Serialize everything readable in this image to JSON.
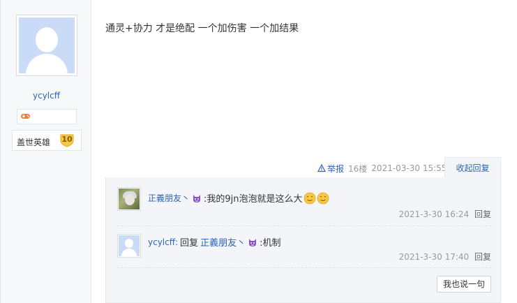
{
  "user": {
    "username": "ycylcff",
    "badge_icon": "gamepad-icon",
    "level_title": "盖世英雄",
    "level_number": "10"
  },
  "post": {
    "text": "通灵+协力 才是绝配 一个加伤害 一个加结果",
    "report_label": "举报",
    "floor": "16楼",
    "timestamp": "2021-03-30 15:55",
    "collapse_label": "收起回复"
  },
  "replies": [
    {
      "nickname": "正義朋友丶",
      "icon": "devil-emoji-icon",
      "text": ":我的9jn泡泡就是这么大",
      "emojis": [
        "smile-emoji-icon",
        "smile-emoji-icon"
      ],
      "time": "2021-3-30 16:24",
      "reply_label": "回复"
    },
    {
      "nickname": "ycylcff:",
      "reply_word": "回复",
      "target": "正義朋友丶",
      "icon": "devil-emoji-icon",
      "text": ":机制",
      "time": "2021-3-30 17:40",
      "reply_label": "回复"
    }
  ],
  "say_button_label": "我也说一句",
  "colors": {
    "link": "#2d64b3",
    "meta": "#999999",
    "reply_bg": "#f3f5f8"
  }
}
